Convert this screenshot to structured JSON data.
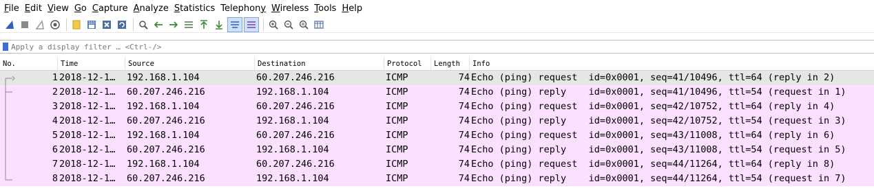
{
  "menu": {
    "items": [
      {
        "u": "F",
        "rest": "ile"
      },
      {
        "u": "E",
        "rest": "dit"
      },
      {
        "u": "V",
        "rest": "iew"
      },
      {
        "u": "G",
        "rest": "o"
      },
      {
        "u": "C",
        "rest": "apture"
      },
      {
        "u": "A",
        "rest": "nalyze"
      },
      {
        "u": "S",
        "rest": "tatistics"
      },
      {
        "pre": "Telephon",
        "u": "y",
        "rest": ""
      },
      {
        "u": "W",
        "rest": "ireless"
      },
      {
        "u": "T",
        "rest": "ools"
      },
      {
        "u": "H",
        "rest": "elp"
      }
    ]
  },
  "toolbar": {
    "icons": [
      "shark-fin-start-icon",
      "stop-square-icon",
      "restart-fin-icon",
      "capture-options-gear-icon",
      "open-folder-icon",
      "save-file-icon",
      "close-file-icon",
      "reload-file-icon",
      "find-packet-icon",
      "go-back-icon",
      "go-forward-icon",
      "go-to-packet-icon",
      "first-packet-icon",
      "last-packet-icon",
      "autoscroll-icon",
      "colorize-icon",
      "zoom-in-icon",
      "zoom-out-icon",
      "normal-size-icon",
      "resize-columns-icon"
    ]
  },
  "filter": {
    "placeholder": "Apply a display filter … <Ctrl-/>"
  },
  "columns": {
    "no": "No.",
    "time": "Time",
    "source": "Source",
    "destination": "Destination",
    "protocol": "Protocol",
    "length": "Length",
    "info": "Info"
  },
  "packets": [
    {
      "no": "1",
      "time": "2018-12-1…",
      "source": "192.168.1.104",
      "destination": "60.207.246.216",
      "protocol": "ICMP",
      "length": "74",
      "info": "Echo (ping) request  id=0x0001, seq=41/10496, ttl=64 (reply in 2)"
    },
    {
      "no": "2",
      "time": "2018-12-1…",
      "source": "60.207.246.216",
      "destination": "192.168.1.104",
      "protocol": "ICMP",
      "length": "74",
      "info": "Echo (ping) reply    id=0x0001, seq=41/10496, ttl=54 (request in 1)"
    },
    {
      "no": "3",
      "time": "2018-12-1…",
      "source": "192.168.1.104",
      "destination": "60.207.246.216",
      "protocol": "ICMP",
      "length": "74",
      "info": "Echo (ping) request  id=0x0001, seq=42/10752, ttl=64 (reply in 4)"
    },
    {
      "no": "4",
      "time": "2018-12-1…",
      "source": "60.207.246.216",
      "destination": "192.168.1.104",
      "protocol": "ICMP",
      "length": "74",
      "info": "Echo (ping) reply    id=0x0001, seq=42/10752, ttl=54 (request in 3)"
    },
    {
      "no": "5",
      "time": "2018-12-1…",
      "source": "192.168.1.104",
      "destination": "60.207.246.216",
      "protocol": "ICMP",
      "length": "74",
      "info": "Echo (ping) request  id=0x0001, seq=43/11008, ttl=64 (reply in 6)"
    },
    {
      "no": "6",
      "time": "2018-12-1…",
      "source": "60.207.246.216",
      "destination": "192.168.1.104",
      "protocol": "ICMP",
      "length": "74",
      "info": "Echo (ping) reply    id=0x0001, seq=43/11008, ttl=54 (request in 5)"
    },
    {
      "no": "7",
      "time": "2018-12-1…",
      "source": "192.168.1.104",
      "destination": "60.207.246.216",
      "protocol": "ICMP",
      "length": "74",
      "info": "Echo (ping) request  id=0x0001, seq=44/11264, ttl=64 (reply in 8)"
    },
    {
      "no": "8",
      "time": "2018-12-1…",
      "source": "60.207.246.216",
      "destination": "192.168.1.104",
      "protocol": "ICMP",
      "length": "74",
      "info": "Echo (ping) reply    id=0x0001, seq=44/11264, ttl=54 (request in 7)"
    }
  ],
  "colors": {
    "icmp_row_bg": "#fce0ff",
    "selected_row_bg": "#e6e6e6",
    "accent": "#3c6fd1"
  }
}
